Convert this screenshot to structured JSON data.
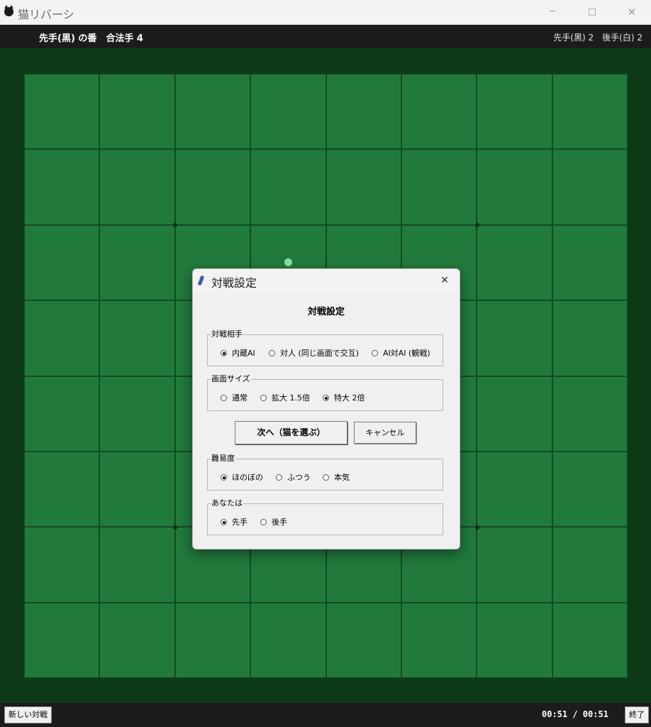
{
  "window": {
    "title": "猫リバーシ",
    "minimize": "─",
    "maximize": "□",
    "close": "✕"
  },
  "infobar": {
    "turn": "先手(黒) の番　合法手 4",
    "score": "先手(黒) 2　後手(白) 2"
  },
  "bottombar": {
    "new_game": "新しい対戦",
    "timer": "00:51 / 00:51",
    "quit": "終了"
  },
  "dialog": {
    "title": "対戦設定",
    "close": "✕",
    "heading": "対戦設定",
    "opponent": {
      "label": "対戦相手",
      "options": [
        "内蔵AI",
        "対人 (同じ画面で交互)",
        "AI対AI (観戦)"
      ],
      "selected": "内蔵AI"
    },
    "screen_size": {
      "label": "画面サイズ",
      "options": [
        "通常",
        "拡大 1.5倍",
        "特大 2倍"
      ],
      "selected": "特大 2倍"
    },
    "next_button": "次へ（猫を選ぶ）",
    "cancel_button": "キャンセル",
    "difficulty": {
      "label": "難易度",
      "options": [
        "ほのぼの",
        "ふつう",
        "本気"
      ],
      "selected": "ほのぼの"
    },
    "you_are": {
      "label": "あなたは",
      "options": [
        "先手",
        "後手"
      ],
      "selected": "先手"
    }
  },
  "colors": {
    "board_green": "#217a3c",
    "background": "#0d3b18",
    "bar": "#1c1c1c"
  }
}
